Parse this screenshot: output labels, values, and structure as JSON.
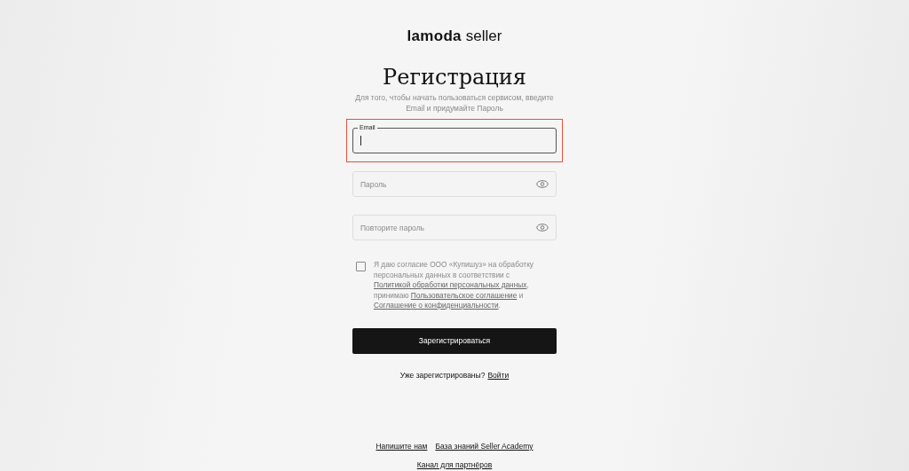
{
  "logo": {
    "brand": "lamoda",
    "suffix": "seller"
  },
  "title": "Регистрация",
  "subtitle": "Для того, чтобы начать пользоваться сервисом, введите Email и придумайте Пароль",
  "fields": [
    {
      "kind": "text",
      "label": "Email",
      "focused": true,
      "highlighted": true
    },
    {
      "kind": "password",
      "placeholder": "Пароль",
      "focused": false,
      "highlighted": false
    },
    {
      "kind": "password",
      "placeholder": "Повторите пароль",
      "focused": false,
      "highlighted": false
    }
  ],
  "consent": {
    "checked": false,
    "parts": [
      {
        "kind": "text",
        "text": "Я даю согласие ООО «Купишуз» на обработку персональных данных в соответствии с "
      },
      {
        "kind": "link",
        "text": "Политикой обработки персональных данных"
      },
      {
        "kind": "text",
        "text": ", принимаю "
      },
      {
        "kind": "link",
        "text": "Пользовательское соглашение"
      },
      {
        "kind": "text",
        "text": " и "
      },
      {
        "kind": "link",
        "text": "Соглашение о конфиденциальности"
      },
      {
        "kind": "text",
        "text": "."
      }
    ]
  },
  "submit": "Зарегистрироваться",
  "login": {
    "question": "Уже зарегистрированы?",
    "link": "Войти"
  },
  "footer": [
    [
      "Напишите нам",
      "База знаний Seller Academy"
    ],
    [
      "Канал для партнёров"
    ]
  ]
}
